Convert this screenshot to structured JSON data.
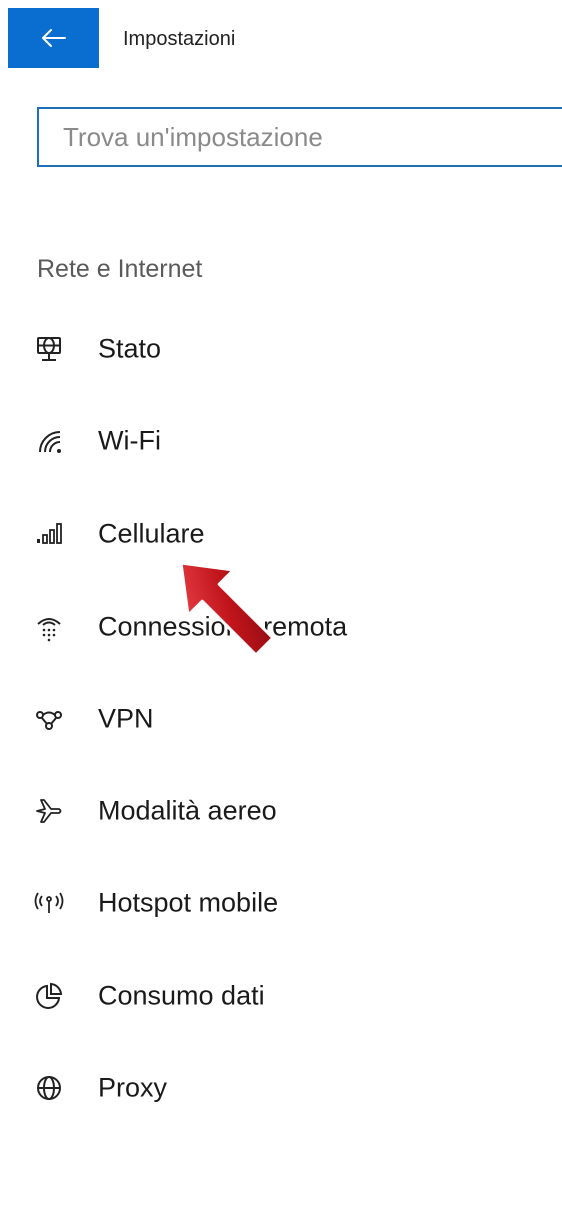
{
  "window": {
    "title": "Impostazioni"
  },
  "search": {
    "placeholder": "Trova un'impostazione",
    "value": ""
  },
  "section": {
    "heading": "Rete e Internet"
  },
  "nav": {
    "items": [
      {
        "label": "Stato",
        "icon": "network-status-icon"
      },
      {
        "label": "Wi-Fi",
        "icon": "wifi-icon"
      },
      {
        "label": "Cellulare",
        "icon": "cellular-signal-icon"
      },
      {
        "label": "Connessione remota",
        "icon": "dial-up-icon"
      },
      {
        "label": "VPN",
        "icon": "vpn-icon"
      },
      {
        "label": "Modalità aereo",
        "icon": "airplane-icon"
      },
      {
        "label": "Hotspot mobile",
        "icon": "hotspot-icon"
      },
      {
        "label": "Consumo dati",
        "icon": "data-usage-icon"
      },
      {
        "label": "Proxy",
        "icon": "globe-icon"
      }
    ]
  },
  "colors": {
    "accent": "#0a6ed1",
    "annotation_arrow": "#c0141b"
  }
}
